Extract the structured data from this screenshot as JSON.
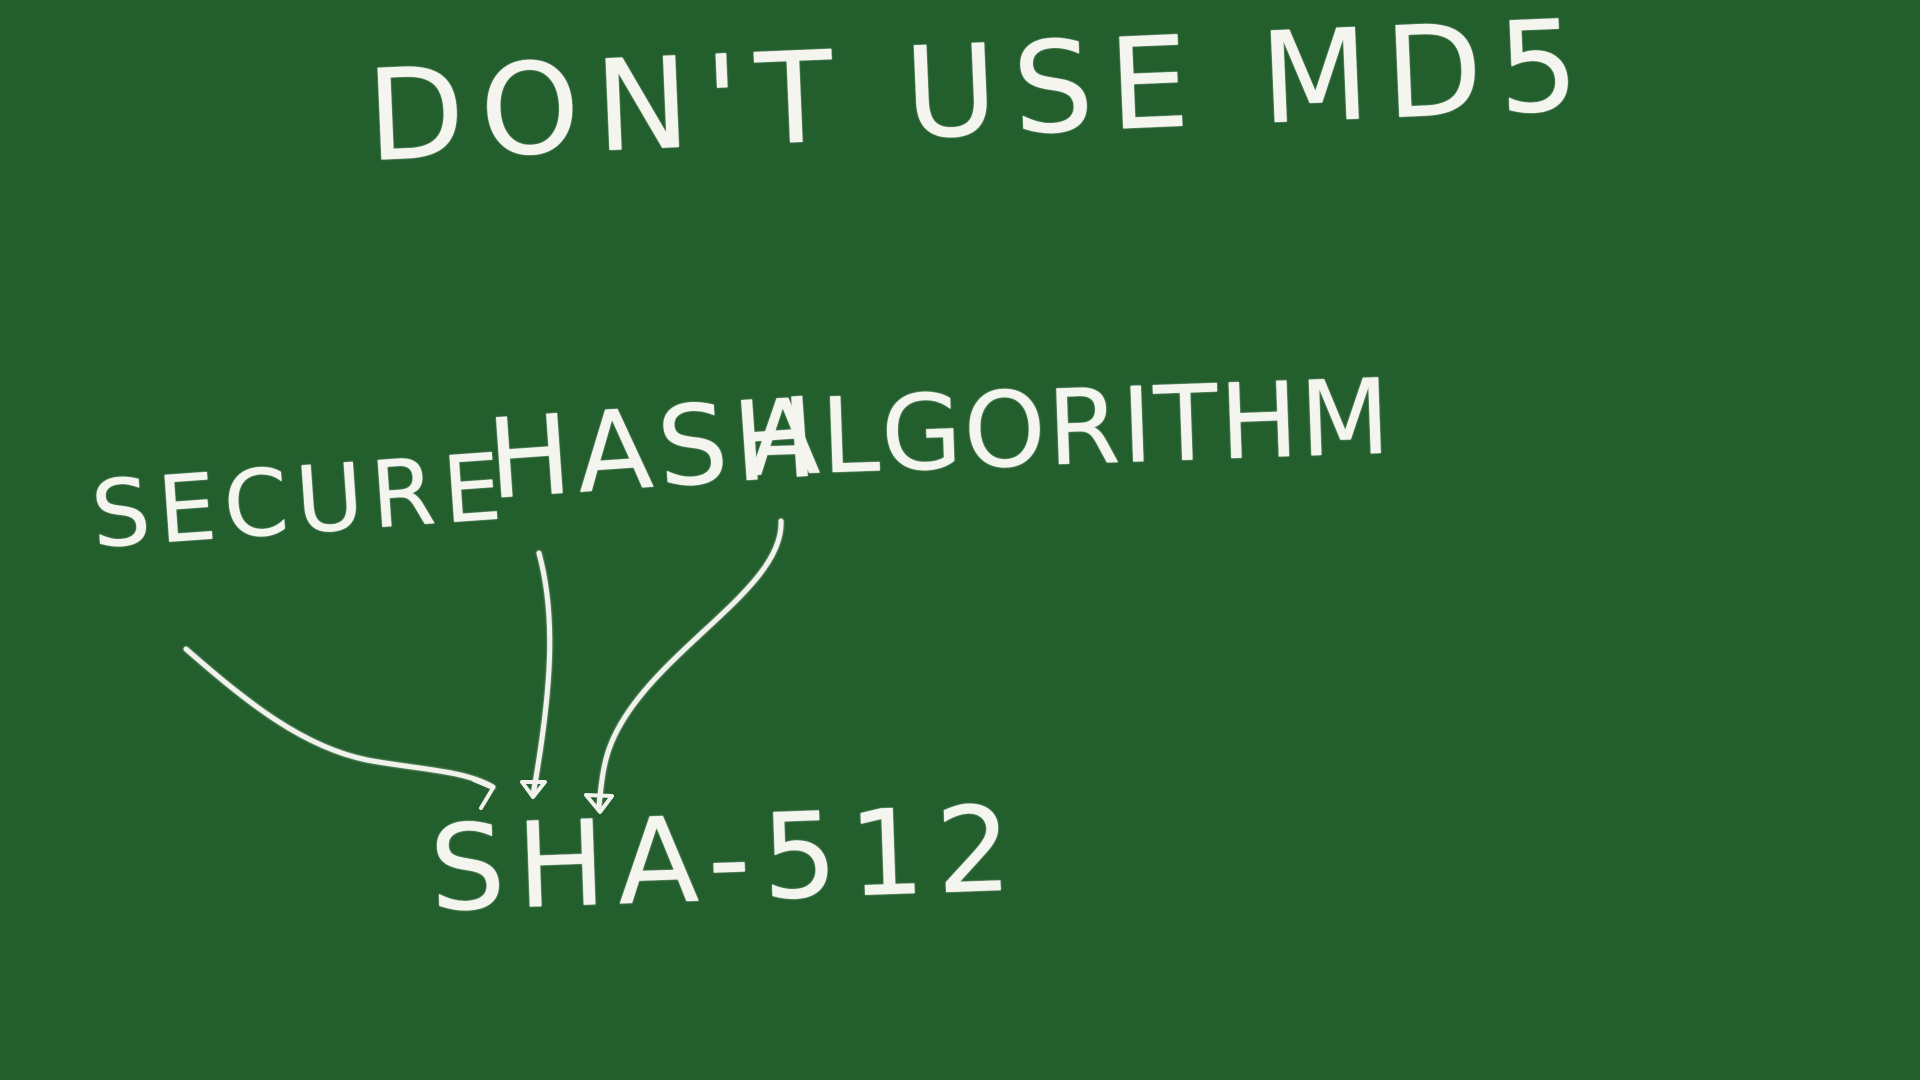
{
  "board": {
    "background_color": "#235e2d",
    "chalk_color": "#f4f5ef"
  },
  "title": {
    "text": "DON'T USE MD5"
  },
  "expansion": {
    "words": [
      "SECURE",
      "HASH",
      "ALGORITHM"
    ]
  },
  "acronym": {
    "text": "SHA-512"
  },
  "arrows": {
    "icon_name": "arrow-icon",
    "count": 3
  }
}
